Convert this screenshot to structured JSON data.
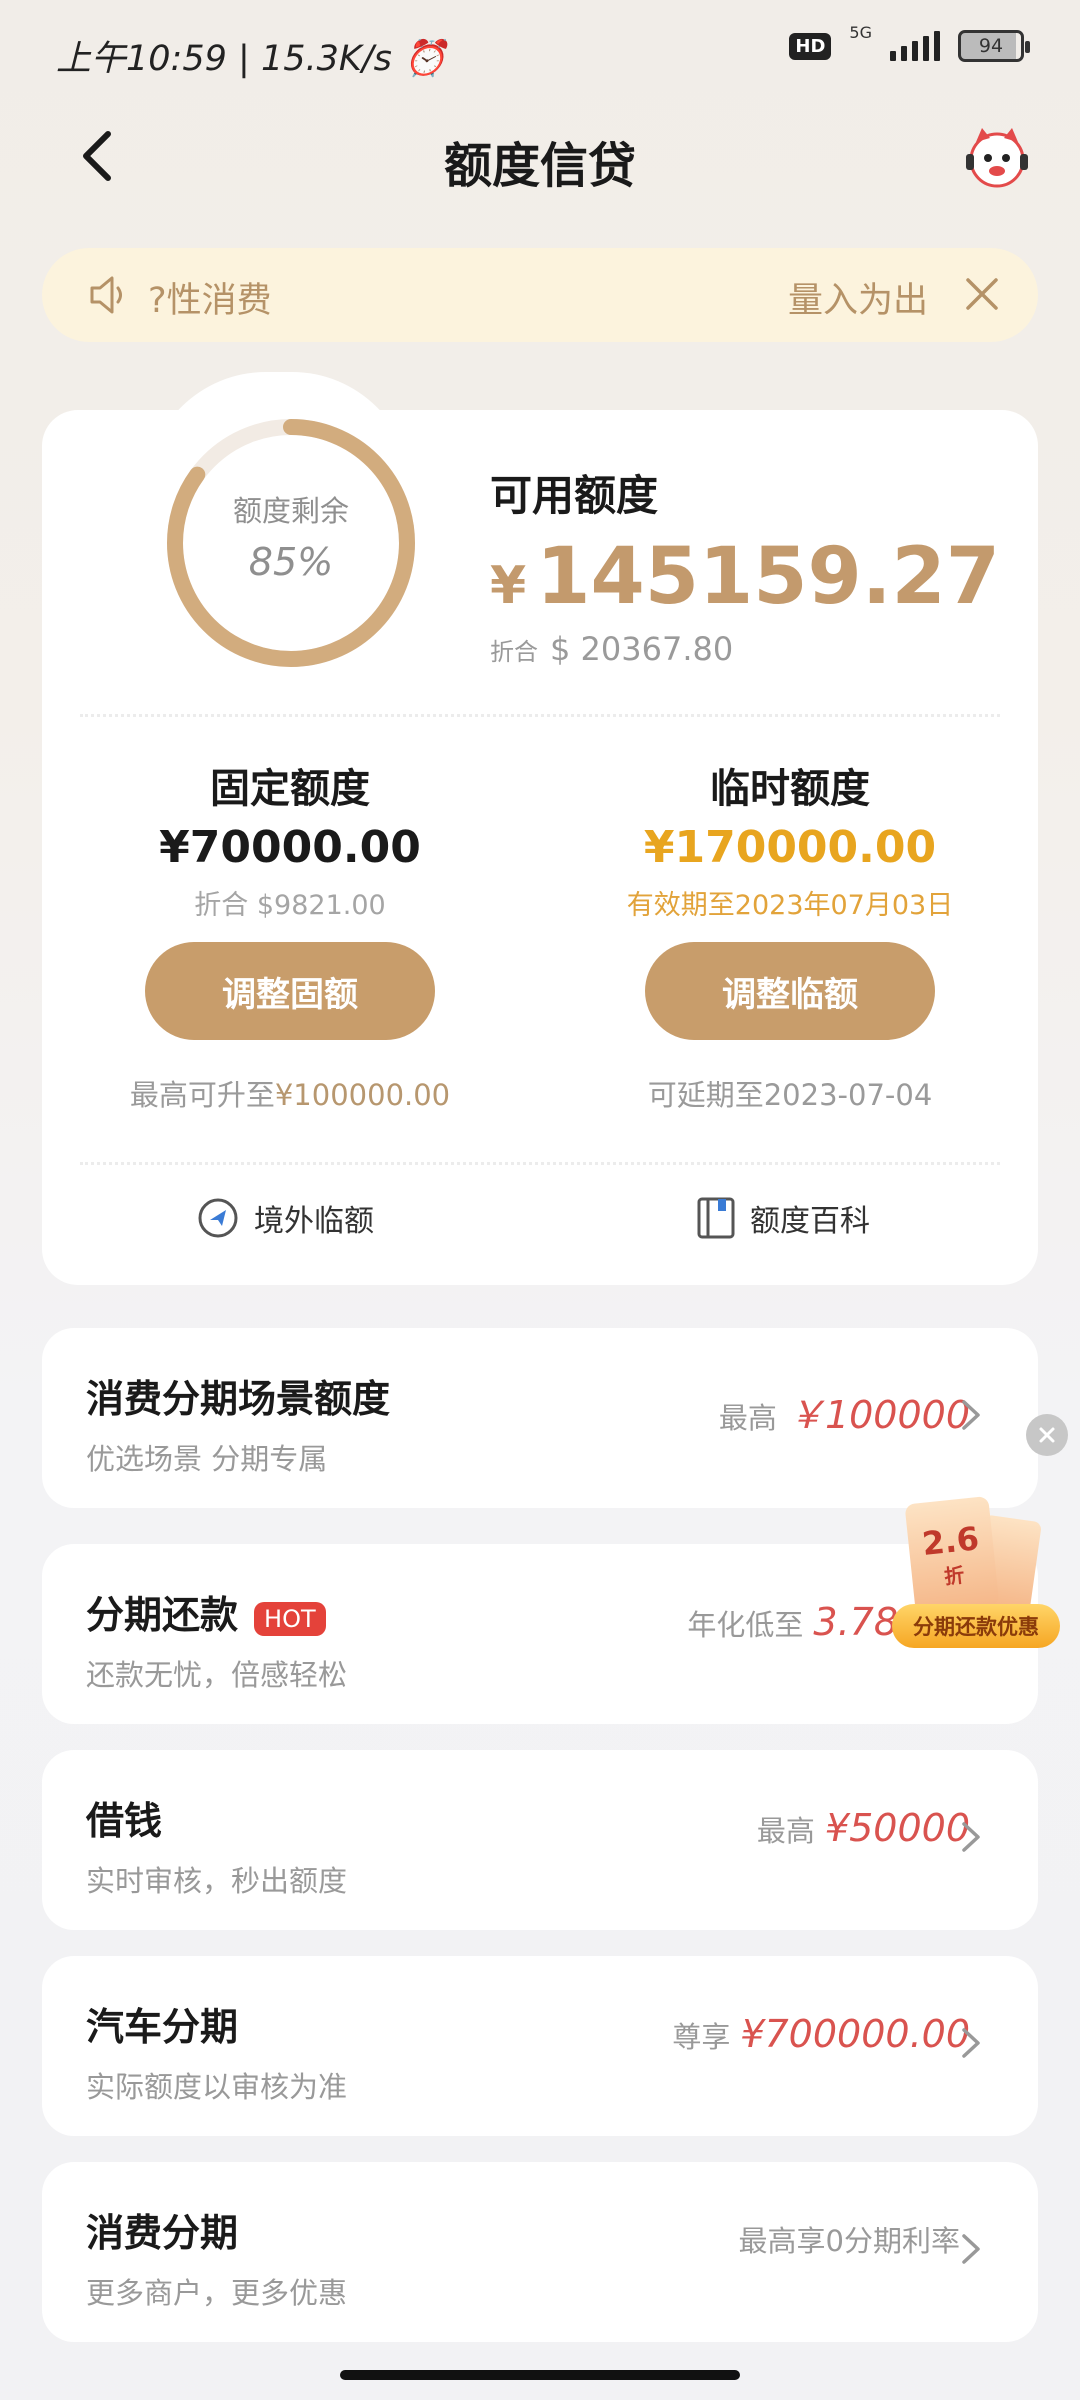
{
  "status_bar": {
    "time": "上午10:59",
    "speed": "15.3K/s",
    "hd": "HD",
    "network": "5G",
    "battery": "94"
  },
  "header": {
    "title": "额度信贷"
  },
  "notice": {
    "text": "?性消费",
    "right_text": "量入为出"
  },
  "credit": {
    "ring_label": "额度剩余",
    "ring_percent": "85%",
    "ring_fraction": 0.85,
    "available_label": "可用额度",
    "available_currency": "¥",
    "available_amount": "145159.27",
    "available_usd_prefix": "折合",
    "available_usd": "$ 20367.80"
  },
  "fixed": {
    "title": "固定额度",
    "amount": "¥70000.00",
    "usd": "折合 $9821.00",
    "button": "调整固额",
    "note_prefix": "最高可升至",
    "note_value": "¥100000.00"
  },
  "temp": {
    "title": "临时额度",
    "amount": "¥170000.00",
    "valid": "有效期至2023年07月03日",
    "button": "调整临额",
    "note_prefix": "可延期至",
    "note_value": "2023-07-04"
  },
  "quick_links": {
    "overseas": "境外临额",
    "wiki": "额度百科"
  },
  "list": [
    {
      "title": "消费分期场景额度",
      "sub": "优选场景 分期专属",
      "prefix": "最高",
      "value": "￥100000"
    },
    {
      "title": "分期还款",
      "hot": "HOT",
      "sub": "还款无忧，倍感轻松",
      "prefix": "年化低至",
      "value": "3.78"
    },
    {
      "title": "借钱",
      "sub": "实时审核，秒出额度",
      "prefix": "最高",
      "value": "¥50000"
    },
    {
      "title": "汽车分期",
      "sub": "实际额度以审核为准",
      "prefix": "尊享",
      "value": "¥700000.00"
    },
    {
      "title": "消费分期",
      "sub": "更多商户，更多优惠",
      "prefix": "最高享0分期利率",
      "value": ""
    }
  ],
  "promo": {
    "discount": "2.6",
    "unit": "折",
    "label": "分期还款优惠"
  },
  "colors": {
    "accent": "#c89d6b",
    "gold": "#e8a51f",
    "red": "#d9534f"
  }
}
